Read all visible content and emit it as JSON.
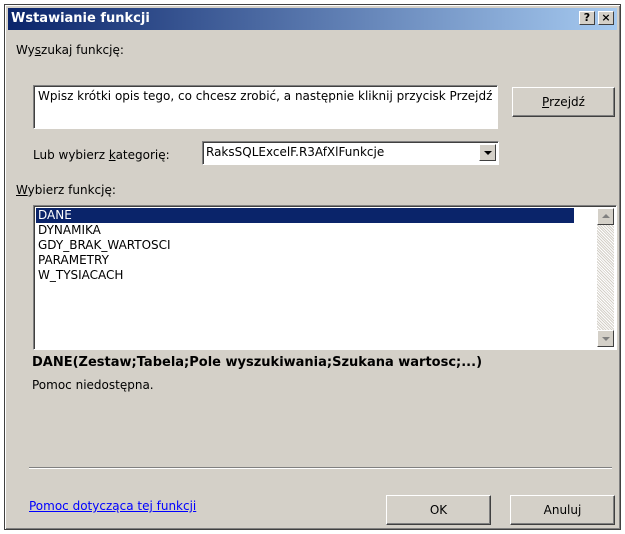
{
  "window": {
    "title": "Wstawianie funkcji",
    "help_glyph": "?",
    "close_glyph": "×"
  },
  "search": {
    "label_before": "Wy",
    "label_key": "s",
    "label_after": "zukaj funkcję:",
    "value": "Wpisz krótki opis tego, co chcesz zrobić, a następnie kliknij przycisk Przejdź",
    "go_key": "P",
    "go_rest": "rzejdź"
  },
  "category": {
    "label_before": "Lub wybierz ",
    "label_key": "k",
    "label_after": "ategorię:",
    "selected": "RaksSQLExcelF.R3AfXlFunkcje"
  },
  "functions": {
    "label_key": "W",
    "label_after": "ybierz funkcję:",
    "items": [
      "DANE",
      "DYNAMIKA",
      "GDY_BRAK_WARTOSCI",
      "PARAMETRY",
      "W_TYSIACACH"
    ],
    "selected_index": 0
  },
  "details": {
    "signature": "DANE(Zestaw;Tabela;Pole wyszukiwania;Szukana wartosc;...)",
    "description": "Pomoc niedostępna."
  },
  "footer": {
    "help_link": "Pomoc dotycząca tej funkcji",
    "ok_label": "OK",
    "cancel_label": "Anuluj"
  }
}
